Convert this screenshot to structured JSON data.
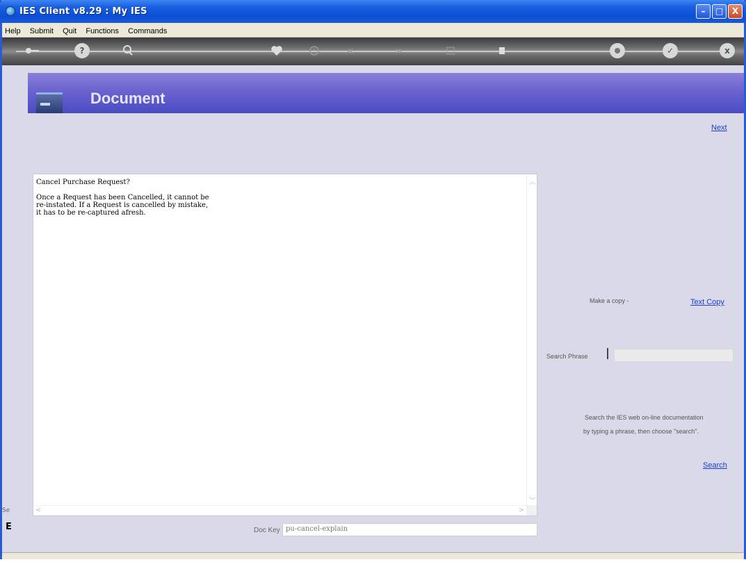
{
  "window": {
    "title": "IES Client v8.29 : My IES",
    "controls": {
      "minimize": "–",
      "maximize": "□",
      "close": "X"
    }
  },
  "menubar": {
    "items": [
      "Help",
      "Submit",
      "Quit",
      "Functions",
      "Commands"
    ]
  },
  "toolbar": {
    "icons": [
      "key-icon",
      "help-icon",
      "search-icon",
      "heart-icon",
      "clock-icon",
      "back-icon",
      "forward-icon",
      "text-icon",
      "stop-icon",
      "settings-icon",
      "ok-icon",
      "cancel-icon"
    ],
    "glyphs": {
      "help": "?",
      "back": "«",
      "forward": "»",
      "ok": "✓",
      "cancel": "x"
    }
  },
  "banner": {
    "title": "Document"
  },
  "links": {
    "next": "Next",
    "text_copy": "Text Copy",
    "search": "Search"
  },
  "document": {
    "text": "Cancel Purchase Request?\n\nOnce a Request has been Cancelled, it cannot be\nre-instated. If a Request is cancelled by mistake,\nit has to be re-captured afresh."
  },
  "copy_section": {
    "label": "Make a copy -"
  },
  "search_section": {
    "label": "Search Phrase",
    "value": "",
    "help_line1": "Search the IES web on-line documentation",
    "help_line2": "by typing a phrase, then choose \"search\"."
  },
  "dockey": {
    "label": "Doc Key",
    "value": "pu-cancel-explain"
  },
  "side_fragments": {
    "top": "Se",
    "bottom": "E"
  }
}
